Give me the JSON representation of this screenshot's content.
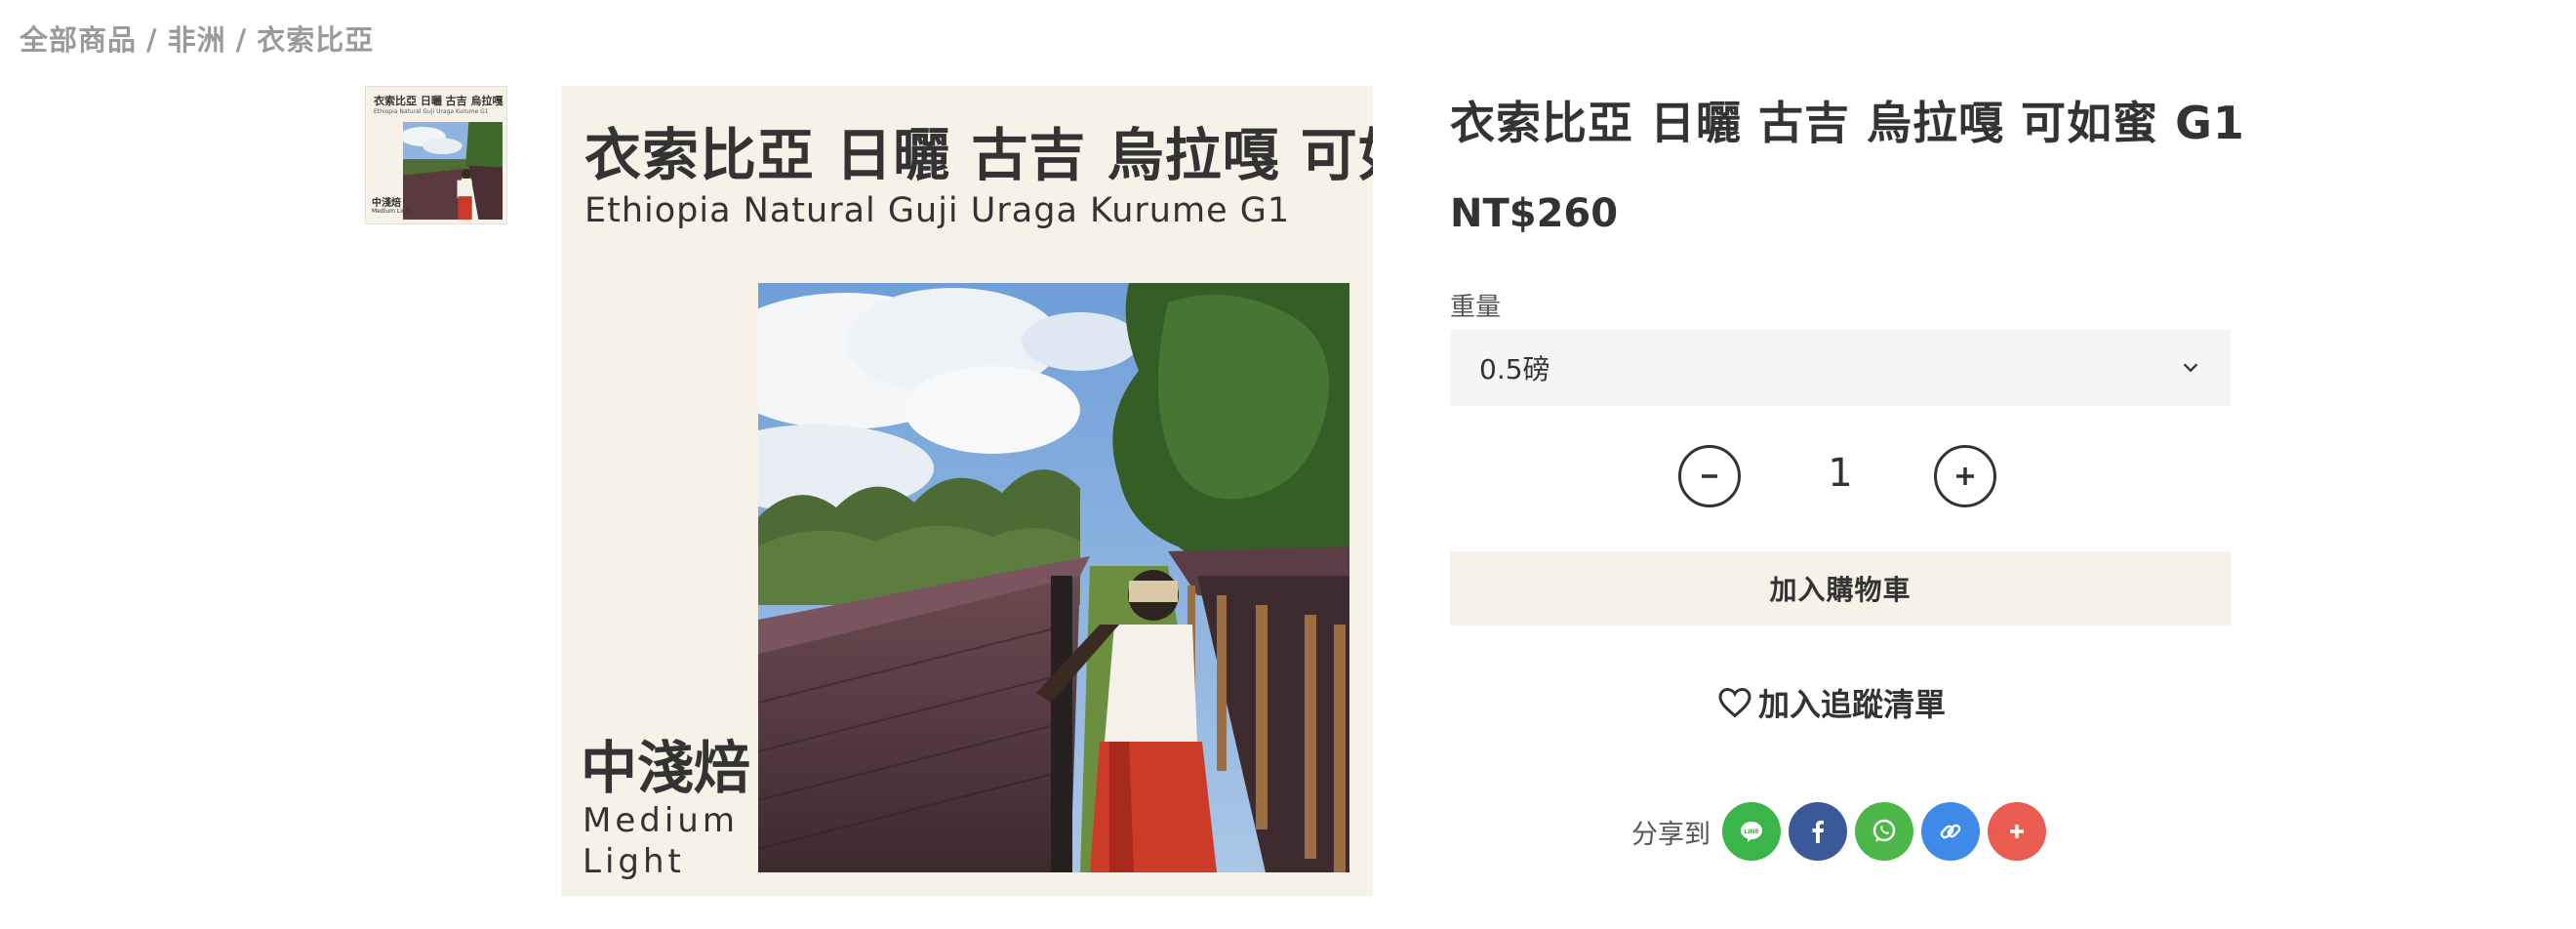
{
  "breadcrumb": {
    "items": [
      "全部商品",
      "非洲",
      "衣索比亞"
    ],
    "separator": "/"
  },
  "product_image": {
    "title_cn": "衣索比亞 日曬 古吉 烏拉嘎 可如蜜",
    "title_en": "Ethiopia Natural Guji Uraga Kurume G1",
    "roast_cn": "中淺焙",
    "roast_en": "Medium Light"
  },
  "thumbnail": {
    "title_cn": "衣索比亞 日曬 古吉 烏拉嘎 可如蜜",
    "title_en": "Ethiopia Natural Guji Uraga Kurume G1",
    "roast_cn": "中淺焙",
    "roast_en": "Medium Light"
  },
  "product": {
    "title": "衣索比亞 日曬 古吉 烏拉嘎 可如蜜 G1",
    "price": "NT$260"
  },
  "weight": {
    "label": "重量",
    "selected": "0.5磅"
  },
  "quantity": {
    "value": "1"
  },
  "actions": {
    "add_to_cart": "加入購物車",
    "wishlist": "加入追蹤清單"
  },
  "share": {
    "label": "分享到",
    "buttons": [
      {
        "name": "line",
        "icon": "line-icon",
        "color": "#3ab549"
      },
      {
        "name": "facebook",
        "icon": "facebook-icon",
        "color": "#3b5998"
      },
      {
        "name": "whatsapp",
        "icon": "whatsapp-icon",
        "color": "#4cb748"
      },
      {
        "name": "copy-link",
        "icon": "link-icon",
        "color": "#3d8ae8"
      },
      {
        "name": "more",
        "icon": "plus-icon",
        "color": "#e95c4f"
      }
    ]
  },
  "colors": {
    "beige": "#f6f2e8",
    "select_bg": "#f5f5f5",
    "text": "#333333",
    "muted": "#9a9a9a"
  }
}
